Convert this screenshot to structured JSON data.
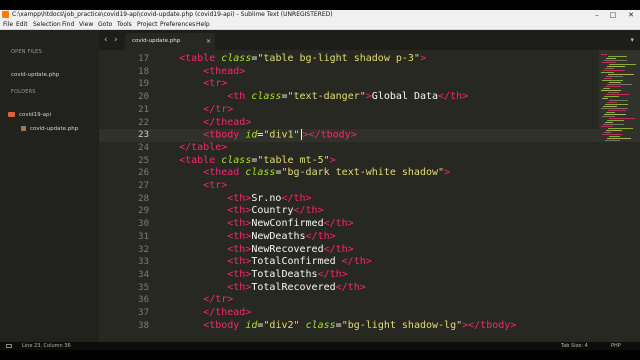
{
  "window": {
    "title": "C:\\xampp\\htdocs\\job_practice\\covid19-api\\covid-update.php (covid19-api) - Sublime Text (UNREGISTERED)",
    "minimize": "–",
    "maximize": "□",
    "close": "✕"
  },
  "menu": [
    "File",
    "Edit",
    "Selection",
    "Find",
    "View",
    "Goto",
    "Tools",
    "Project",
    "Preferences",
    "Help"
  ],
  "sidebar": {
    "open_files_header": "OPEN FILES",
    "open_file": "covid-update.php",
    "folders_header": "FOLDERS",
    "folder": "covid19-api",
    "folder_file": "covid-update.php"
  },
  "tabs": {
    "nav_back": "‹",
    "nav_forward": "›",
    "active_tab": "covid-update.php",
    "close_glyph": "×",
    "dropdown": "▾"
  },
  "editor": {
    "current_line": 23,
    "lines": [
      {
        "n": "17",
        "code": [
          [
            "",
            "    "
          ],
          [
            "tg",
            "<table "
          ],
          [
            "at",
            "class"
          ],
          [
            "tx",
            "="
          ],
          [
            "st",
            "\"table bg-light shadow p-3\""
          ],
          [
            "tg",
            ">"
          ]
        ]
      },
      {
        "n": "18",
        "code": [
          [
            "",
            "        "
          ],
          [
            "tg",
            "<thead>"
          ]
        ]
      },
      {
        "n": "19",
        "code": [
          [
            "",
            "        "
          ],
          [
            "tg",
            "<tr>"
          ]
        ]
      },
      {
        "n": "20",
        "code": [
          [
            "",
            "            "
          ],
          [
            "tg",
            "<th "
          ],
          [
            "at",
            "class"
          ],
          [
            "tx",
            "="
          ],
          [
            "st",
            "\"text-danger\""
          ],
          [
            "tg",
            ">"
          ],
          [
            "tx",
            "Global Data"
          ],
          [
            "tg",
            "</th>"
          ]
        ]
      },
      {
        "n": "21",
        "code": [
          [
            "",
            "        "
          ],
          [
            "tg",
            "</tr>"
          ]
        ]
      },
      {
        "n": "22",
        "code": [
          [
            "",
            "        "
          ],
          [
            "tg",
            "</thead>"
          ]
        ]
      },
      {
        "n": "23",
        "code": [
          [
            "",
            "        "
          ],
          [
            "tg",
            "<tbody "
          ],
          [
            "at",
            "id"
          ],
          [
            "tx",
            "="
          ],
          [
            "st",
            "\"div1\""
          ],
          [
            "caret",
            ""
          ],
          [
            "tg",
            "></tbody>"
          ]
        ]
      },
      {
        "n": "24",
        "code": [
          [
            "",
            "    "
          ],
          [
            "tg",
            "</table>"
          ]
        ]
      },
      {
        "n": "25",
        "code": [
          [
            "",
            "    "
          ],
          [
            "tg",
            "<table "
          ],
          [
            "at",
            "class"
          ],
          [
            "tx",
            "="
          ],
          [
            "st",
            "\"table mt-5\""
          ],
          [
            "tg",
            ">"
          ]
        ]
      },
      {
        "n": "26",
        "code": [
          [
            "",
            "        "
          ],
          [
            "tg",
            "<thead "
          ],
          [
            "at",
            "class"
          ],
          [
            "tx",
            "="
          ],
          [
            "st",
            "\"bg-dark text-white shadow\""
          ],
          [
            "tg",
            ">"
          ]
        ]
      },
      {
        "n": "27",
        "code": [
          [
            "",
            "        "
          ],
          [
            "tg",
            "<tr>"
          ]
        ]
      },
      {
        "n": "28",
        "code": [
          [
            "",
            "            "
          ],
          [
            "tg",
            "<th>"
          ],
          [
            "tx",
            "Sr.no"
          ],
          [
            "tg",
            "</th>"
          ]
        ]
      },
      {
        "n": "29",
        "code": [
          [
            "",
            "            "
          ],
          [
            "tg",
            "<th>"
          ],
          [
            "tx",
            "Country"
          ],
          [
            "tg",
            "</th>"
          ]
        ]
      },
      {
        "n": "30",
        "code": [
          [
            "",
            "            "
          ],
          [
            "tg",
            "<th>"
          ],
          [
            "tx",
            "NewConfirmed"
          ],
          [
            "tg",
            "</th>"
          ]
        ]
      },
      {
        "n": "31",
        "code": [
          [
            "",
            "            "
          ],
          [
            "tg",
            "<th>"
          ],
          [
            "tx",
            "NewDeaths"
          ],
          [
            "tg",
            "</th>"
          ]
        ]
      },
      {
        "n": "32",
        "code": [
          [
            "",
            "            "
          ],
          [
            "tg",
            "<th>"
          ],
          [
            "tx",
            "NewRecovered"
          ],
          [
            "tg",
            "</th>"
          ]
        ]
      },
      {
        "n": "33",
        "code": [
          [
            "",
            "            "
          ],
          [
            "tg",
            "<th>"
          ],
          [
            "tx",
            "TotalConfirmed "
          ],
          [
            "tg",
            "</th>"
          ]
        ]
      },
      {
        "n": "34",
        "code": [
          [
            "",
            "            "
          ],
          [
            "tg",
            "<th>"
          ],
          [
            "tx",
            "TotalDeaths"
          ],
          [
            "tg",
            "</th>"
          ]
        ]
      },
      {
        "n": "35",
        "code": [
          [
            "",
            "            "
          ],
          [
            "tg",
            "<th>"
          ],
          [
            "tx",
            "TotalRecovered"
          ],
          [
            "tg",
            "</th>"
          ]
        ]
      },
      {
        "n": "36",
        "code": [
          [
            "",
            "        "
          ],
          [
            "tg",
            "</tr>"
          ]
        ]
      },
      {
        "n": "37",
        "code": [
          [
            "",
            "        "
          ],
          [
            "tg",
            "</thead>"
          ]
        ]
      },
      {
        "n": "38",
        "code": [
          [
            "",
            "        "
          ],
          [
            "tg",
            "<tbody "
          ],
          [
            "at",
            "id"
          ],
          [
            "tx",
            "="
          ],
          [
            "st",
            "\"div2\""
          ],
          [
            "tx",
            " "
          ],
          [
            "at",
            "class"
          ],
          [
            "tx",
            "="
          ],
          [
            "st",
            "\"bg-light shadow-lg\""
          ],
          [
            "tg",
            "></tbody>"
          ]
        ]
      }
    ]
  },
  "status": {
    "position": "Line 23, Column 36",
    "tab_size": "Tab Size: 4",
    "syntax": "PHP"
  },
  "colors": {
    "tag": "#f92672",
    "attribute": "#a6e22e",
    "string": "#e6db74",
    "text": "#f8f8f2",
    "editor_bg": "#272822",
    "sidebar_bg": "#21221d"
  }
}
